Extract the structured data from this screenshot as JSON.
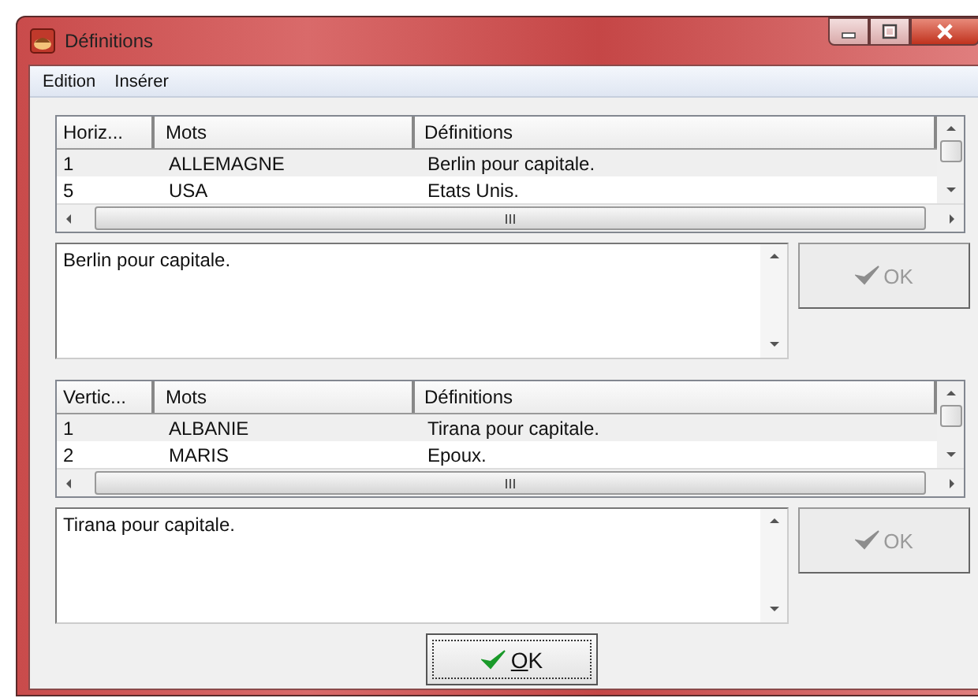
{
  "window": {
    "title": "Définitions"
  },
  "menu": [
    {
      "label": "Edition"
    },
    {
      "label": "Insérer"
    }
  ],
  "sections": [
    {
      "table": {
        "columns": [
          "Horiz...",
          "Mots",
          "Définitions"
        ],
        "rows": [
          {
            "cells": [
              "1",
              "ALLEMAGNE",
              "Berlin pour capitale."
            ],
            "selected": true
          },
          {
            "cells": [
              "5",
              "USA",
              "Etats Unis."
            ],
            "selected": false
          }
        ]
      },
      "definition": {
        "value": "Berlin pour capitale."
      },
      "button": {
        "label": "OK",
        "disabled": true
      }
    },
    {
      "table": {
        "columns": [
          "Vertic...",
          "Mots",
          "Définitions"
        ],
        "rows": [
          {
            "cells": [
              "1",
              "ALBANIE",
              "Tirana pour capitale."
            ],
            "selected": true
          },
          {
            "cells": [
              "2",
              "MARIS",
              "Epoux."
            ],
            "selected": false
          }
        ]
      },
      "definition": {
        "value": "Tirana pour capitale."
      },
      "button": {
        "label": "OK",
        "disabled": true
      }
    }
  ],
  "ok_button": {
    "label": "OK",
    "mnemonic_underlined": true,
    "focused": true
  }
}
